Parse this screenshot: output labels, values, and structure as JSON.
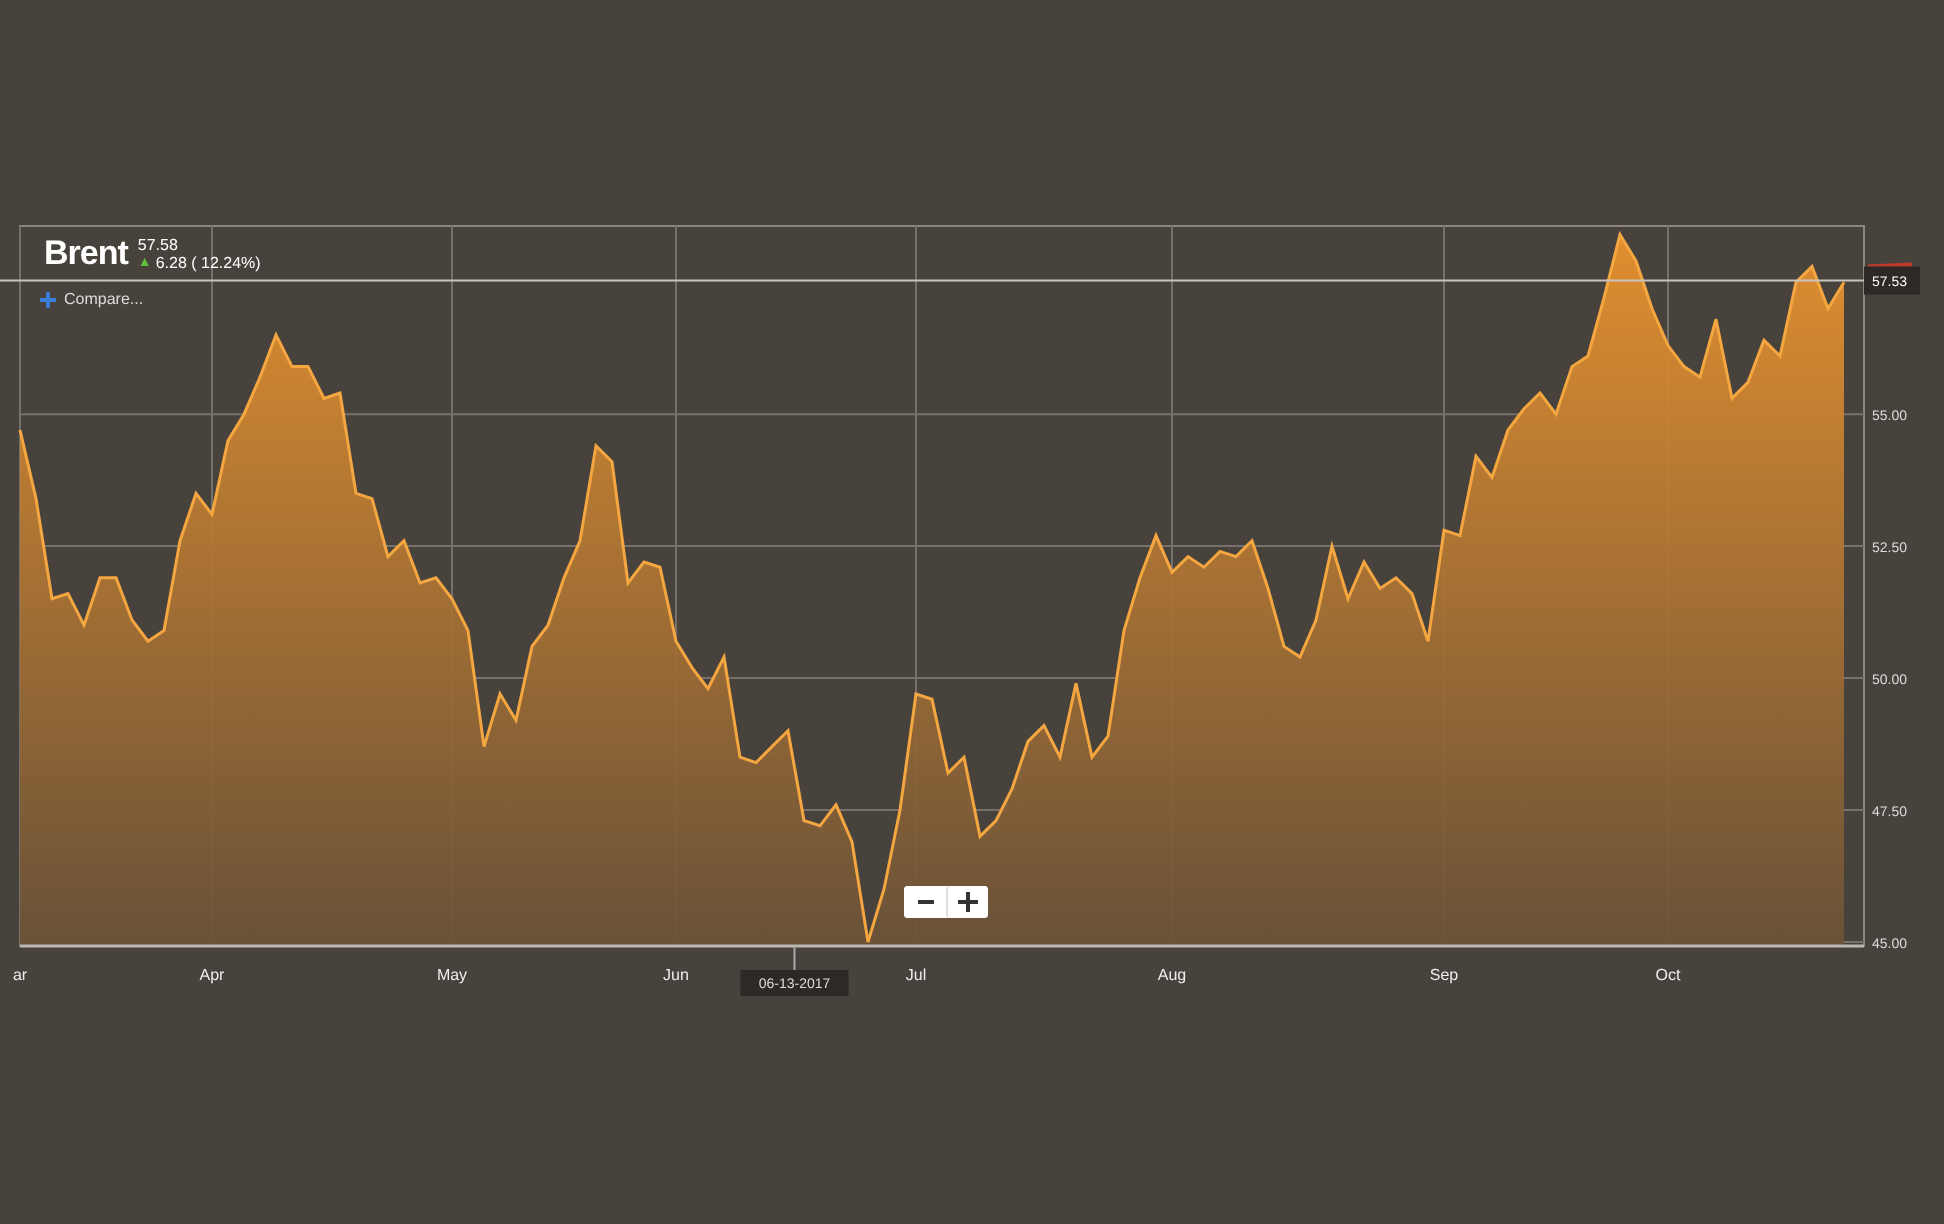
{
  "header": {
    "price": "57.58",
    "change_icon": "▲",
    "change": "6.28 ( 12.24%)",
    "compare": "Compare..."
  },
  "zoom_controls": [
    {
      "kind": "minus"
    },
    {
      "kind": "plus"
    }
  ],
  "chart_data": {
    "type": "area",
    "grid": true,
    "ylim": [
      45,
      58.64
    ],
    "ref_lines": [
      {
        "axis": "y",
        "value": 57.53,
        "label": "57.53"
      }
    ],
    "yticks": [
      {
        "value": 45,
        "label": "45.00"
      },
      {
        "value": 47.5,
        "label": "47.50"
      },
      {
        "value": 50,
        "label": "50.00"
      },
      {
        "value": 52.5,
        "label": "52.50"
      },
      {
        "value": 55,
        "label": "55.00"
      }
    ],
    "categories": [
      "ar",
      null,
      null,
      null,
      null,
      null,
      null,
      null,
      null,
      null,
      null,
      null,
      "Apr",
      null,
      null,
      null,
      null,
      null,
      null,
      null,
      null,
      null,
      null,
      null,
      null,
      null,
      null,
      "May",
      null,
      null,
      null,
      null,
      null,
      null,
      null,
      null,
      null,
      null,
      null,
      null,
      null,
      "Jun",
      null,
      null,
      null,
      null,
      null,
      null,
      null,
      null,
      null,
      null,
      null,
      null,
      null,
      null,
      "Jul",
      null,
      null,
      null,
      null,
      null,
      null,
      null,
      null,
      null,
      null,
      null,
      null,
      null,
      null,
      null,
      "Aug",
      null,
      null,
      null,
      null,
      null,
      null,
      null,
      null,
      null,
      null,
      null,
      null,
      null,
      null,
      null,
      null,
      "Sep",
      null,
      null,
      null,
      null,
      null,
      null,
      null,
      null,
      null,
      null,
      null,
      null,
      null,
      "Oct",
      null,
      null,
      null,
      null,
      null,
      null,
      null,
      null,
      null,
      null,
      null
    ],
    "series": [
      {
        "name": "Brent",
        "color": "#f4a640",
        "values": [
          54.7,
          53.4,
          51.5,
          51.6,
          51.0,
          51.9,
          51.9,
          51.1,
          50.7,
          50.9,
          52.6,
          53.5,
          53.1,
          54.5,
          55.0,
          55.7,
          56.5,
          55.9,
          55.9,
          55.3,
          55.4,
          53.5,
          53.4,
          52.3,
          52.6,
          51.8,
          51.9,
          51.5,
          50.9,
          48.7,
          49.7,
          49.2,
          50.6,
          51.0,
          51.9,
          52.6,
          54.4,
          54.1,
          51.8,
          52.2,
          52.1,
          50.7,
          50.2,
          49.8,
          50.4,
          48.5,
          48.4,
          48.7,
          49.0,
          47.3,
          47.2,
          47.6,
          46.9,
          45.0,
          46.0,
          47.5,
          49.7,
          49.6,
          48.2,
          48.5,
          47.0,
          47.3,
          47.9,
          48.8,
          49.1,
          48.5,
          49.9,
          48.5,
          48.9,
          50.9,
          51.9,
          52.7,
          52.0,
          52.3,
          52.1,
          52.4,
          52.3,
          52.6,
          51.7,
          50.6,
          50.4,
          51.1,
          52.5,
          51.5,
          52.2,
          51.7,
          51.9,
          51.6,
          50.7,
          52.8,
          52.7,
          54.2,
          53.8,
          54.7,
          55.1,
          55.4,
          55.0,
          55.9,
          56.1,
          57.2,
          58.4,
          57.9,
          57.0,
          56.3,
          55.9,
          55.7,
          56.8,
          55.3,
          55.6,
          56.4,
          56.1,
          57.5,
          57.8,
          57.0,
          57.5
        ]
      }
    ],
    "annotations": [
      "06-13-2017"
    ]
  }
}
